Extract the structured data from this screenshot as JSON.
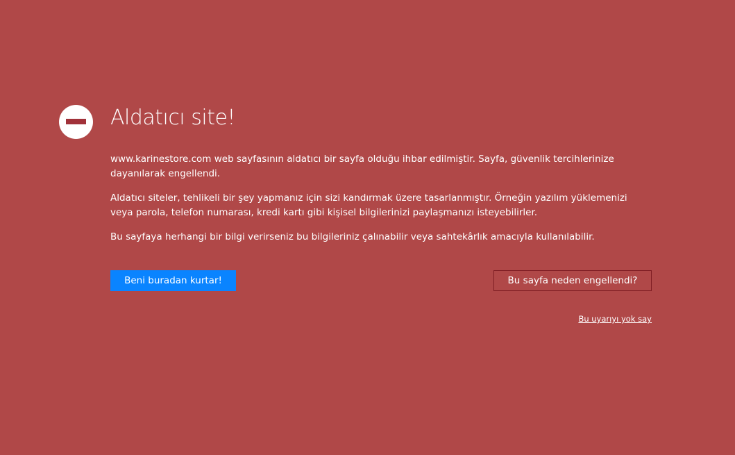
{
  "colors": {
    "background": "#b04848",
    "primary_button": "#0a84ff",
    "secondary_button_border": "#7e1d23",
    "icon_bar": "#a1323a",
    "text": "#ffffff"
  },
  "icon": {
    "name": "blocked-icon"
  },
  "warning": {
    "title": "Aldatıcı site!",
    "paragraphs": [
      "www.karinestore.com web sayfasının aldatıcı bir sayfa olduğu ihbar edilmiştir. Sayfa, güvenlik tercihlerinize dayanılarak engellendi.",
      "Aldatıcı siteler, tehlikeli bir şey yapmanız için sizi kandırmak üzere tasarlanmıştır. Örneğin yazılım yüklemenizi veya parola, telefon numarası, kredi kartı gibi kişisel bilgilerinizi paylaşmanızı isteyebilirler.",
      "Bu sayfaya herhangi bir bilgi verirseniz bu bilgileriniz çalınabilir veya sahtekârlık amacıyla kullanılabilir."
    ]
  },
  "actions": {
    "primary_label": "Beni buradan kurtar!",
    "secondary_label": "Bu sayfa neden engellendi?",
    "ignore_label": "Bu uyarıyı yok say"
  }
}
